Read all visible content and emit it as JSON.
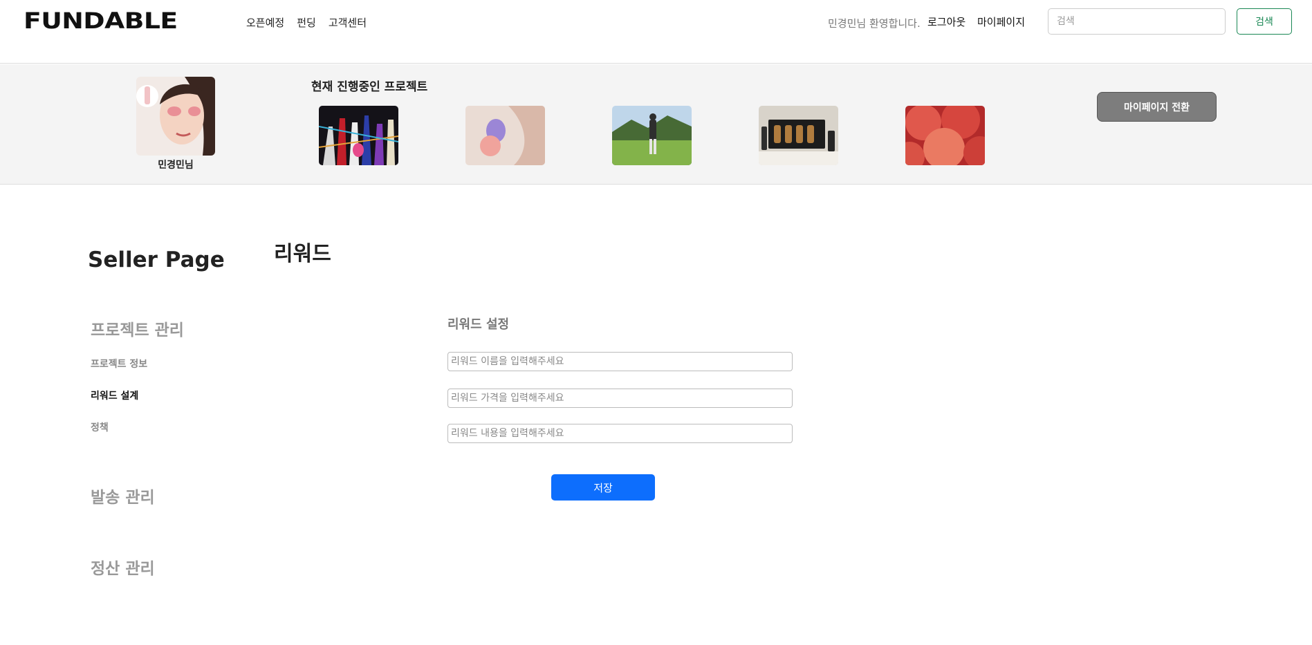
{
  "header": {
    "logo": "FUNDABLE",
    "nav": [
      "오픈예정",
      "펀딩",
      "고객센터"
    ],
    "welcome": "민경민님 환영합니다.",
    "logout": "로그아웃",
    "mypage": "마이페이지",
    "search_placeholder": "검색",
    "search_button": "검색"
  },
  "banner": {
    "profile_name": "민경민님",
    "current_title": "현재 진행중인 프로젝트",
    "switch_button": "마이페이지 전환"
  },
  "sidebar": {
    "title": "Seller Page",
    "project_section": "프로젝트 관리",
    "items": [
      "프로젝트 정보",
      "리워드 설계",
      "정책"
    ],
    "shipping_section": "발송 관리",
    "settlement_section": "정산 관리"
  },
  "main": {
    "heading": "리워드",
    "form_title": "리워드 설정",
    "name_placeholder": "리워드 이름을 입력해주세요",
    "price_placeholder": "리워드 가격을 입력해주세요",
    "content_placeholder": "리워드 내용을 입력해주세요",
    "save_button": "저장"
  },
  "colors": {
    "primary": "#0d6efd",
    "search_green": "#198754",
    "switch_gray": "#7d7d7d"
  }
}
